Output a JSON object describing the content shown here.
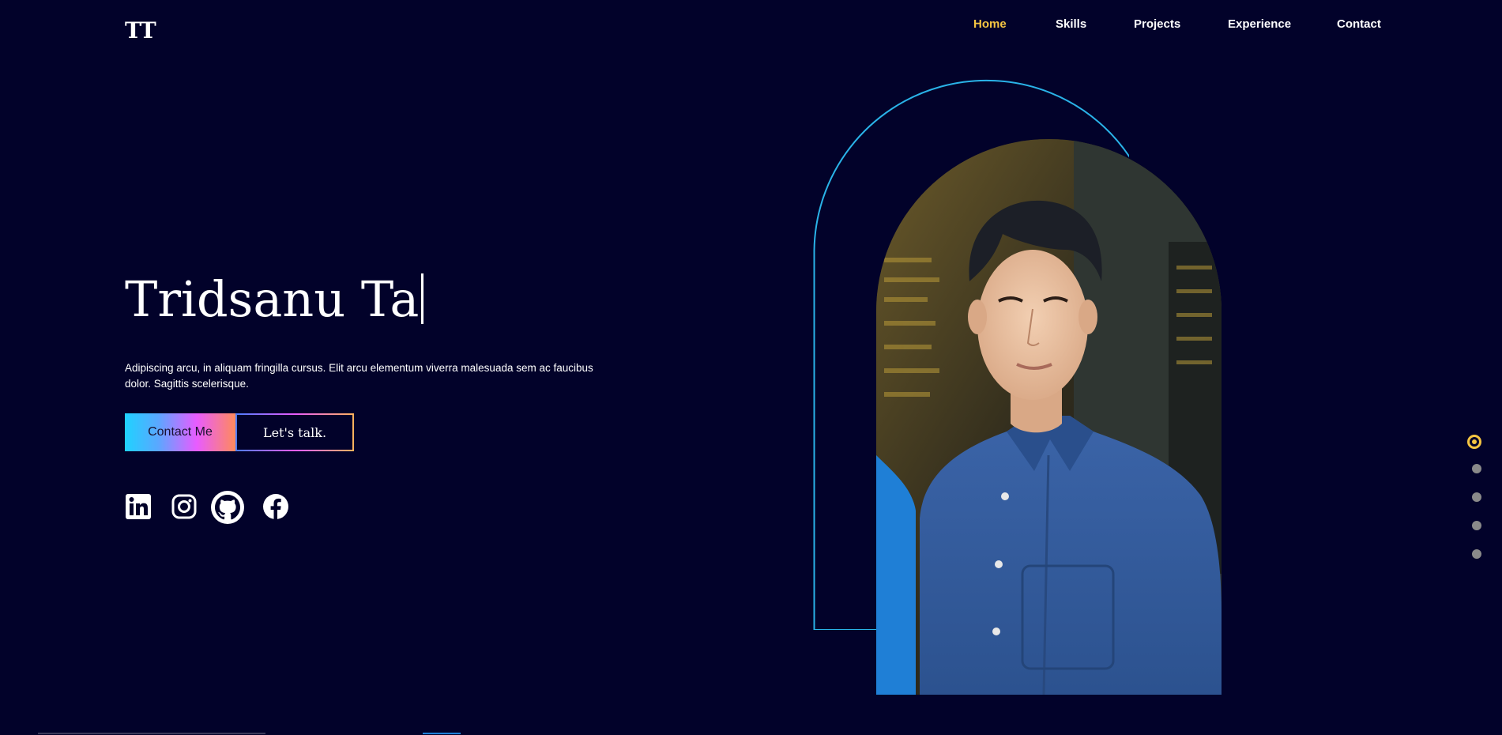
{
  "header": {
    "logo": "TT",
    "nav": [
      {
        "label": "Home",
        "active": true
      },
      {
        "label": "Skills",
        "active": false
      },
      {
        "label": "Projects",
        "active": false
      },
      {
        "label": "Experience",
        "active": false
      },
      {
        "label": "Contact",
        "active": false
      }
    ]
  },
  "hero": {
    "name": "Tridsanu Ta",
    "description": "Adipiscing arcu, in aliquam fringilla cursus. Elit arcu elementum viverra malesuada sem ac faucibus dolor. Sagittis scelerisque.",
    "contact_button": "Contact Me",
    "talk_button": "Let's talk."
  },
  "socials": [
    {
      "icon": "linkedin-icon"
    },
    {
      "icon": "instagram-icon"
    },
    {
      "icon": "github-icon"
    },
    {
      "icon": "facebook-icon"
    }
  ],
  "section_dots": {
    "count": 5,
    "active_index": 0
  },
  "colors": {
    "background": "#02022a",
    "accent": "#f5c542",
    "arch_outline": "#2ab3e8",
    "text": "#ffffff"
  }
}
